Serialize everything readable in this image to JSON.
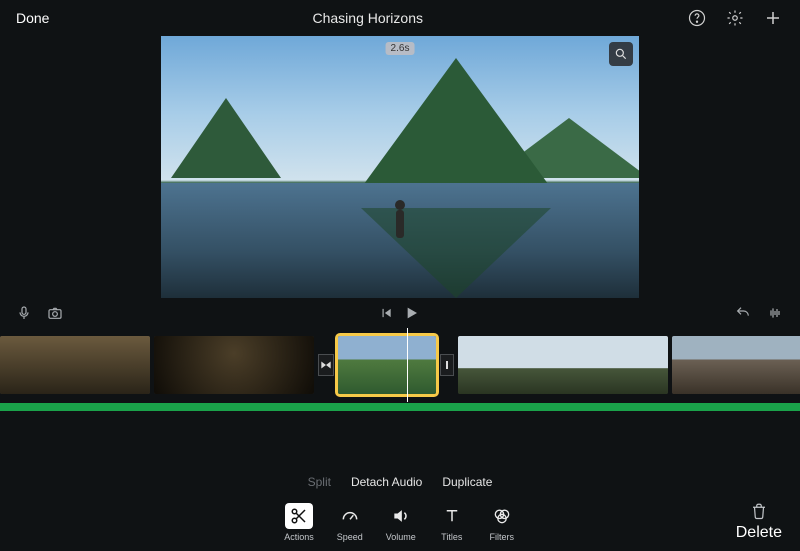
{
  "header": {
    "done_label": "Done",
    "title": "Chasing Horizons"
  },
  "preview": {
    "duration_badge": "2.6s"
  },
  "context_menu": {
    "split": "Split",
    "detach_audio": "Detach Audio",
    "duplicate": "Duplicate"
  },
  "toolbar": {
    "actions": "Actions",
    "speed": "Speed",
    "volume": "Volume",
    "titles": "Titles",
    "filters": "Filters",
    "delete": "Delete"
  },
  "colors": {
    "accent_audio": "#1aa24a",
    "selection": "#f7c948"
  }
}
